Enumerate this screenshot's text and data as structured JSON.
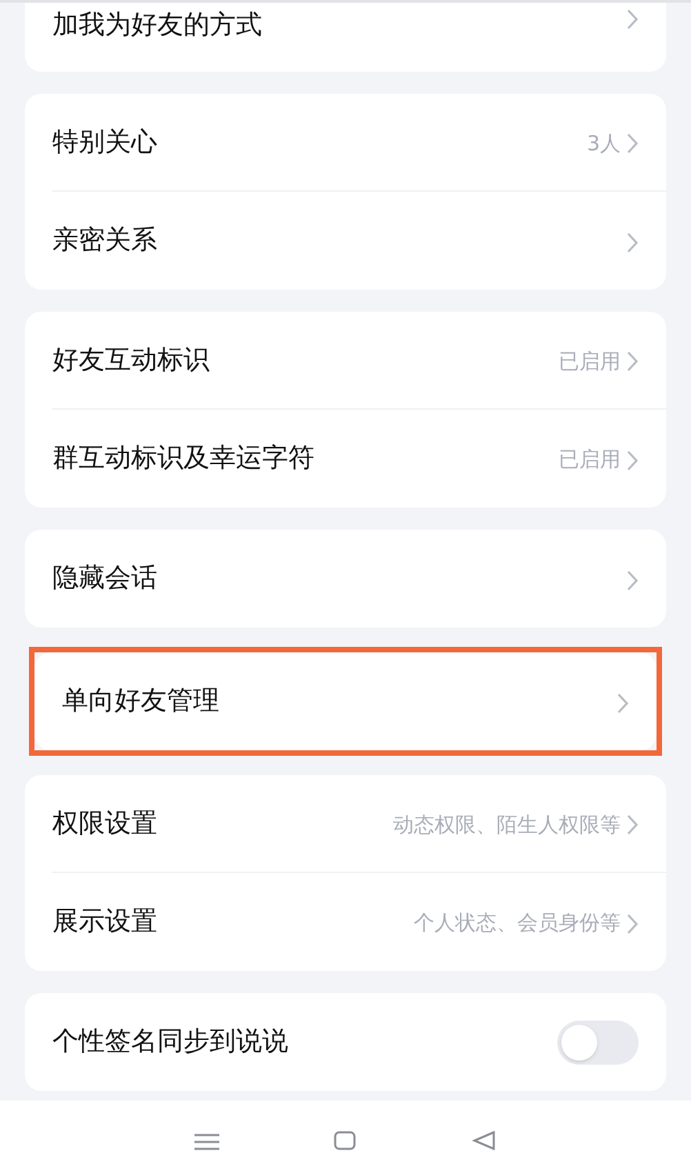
{
  "groups": [
    {
      "highlighted": false,
      "cut_top": true,
      "rows": [
        {
          "kind": "link",
          "label": "加我为好友的方式"
        }
      ]
    },
    {
      "highlighted": false,
      "cut_top": false,
      "rows": [
        {
          "kind": "link",
          "label": "特别关心",
          "value": "3人"
        },
        {
          "kind": "link",
          "label": "亲密关系"
        }
      ]
    },
    {
      "highlighted": false,
      "cut_top": false,
      "rows": [
        {
          "kind": "link",
          "label": "好友互动标识",
          "value": "已启用"
        },
        {
          "kind": "link",
          "label": "群互动标识及幸运字符",
          "value": "已启用"
        }
      ]
    },
    {
      "highlighted": false,
      "cut_top": false,
      "rows": [
        {
          "kind": "link",
          "label": "隐藏会话"
        }
      ]
    },
    {
      "highlighted": true,
      "cut_top": false,
      "rows": [
        {
          "kind": "link",
          "label": "单向好友管理"
        }
      ]
    },
    {
      "highlighted": false,
      "cut_top": false,
      "rows": [
        {
          "kind": "link",
          "label": "权限设置",
          "value": "动态权限、陌生人权限等"
        },
        {
          "kind": "link",
          "label": "展示设置",
          "value": "个人状态、会员身份等"
        }
      ]
    },
    {
      "highlighted": false,
      "cut_top": false,
      "rows": [
        {
          "kind": "toggle",
          "label": "个性签名同步到说说",
          "on": false
        }
      ]
    }
  ]
}
